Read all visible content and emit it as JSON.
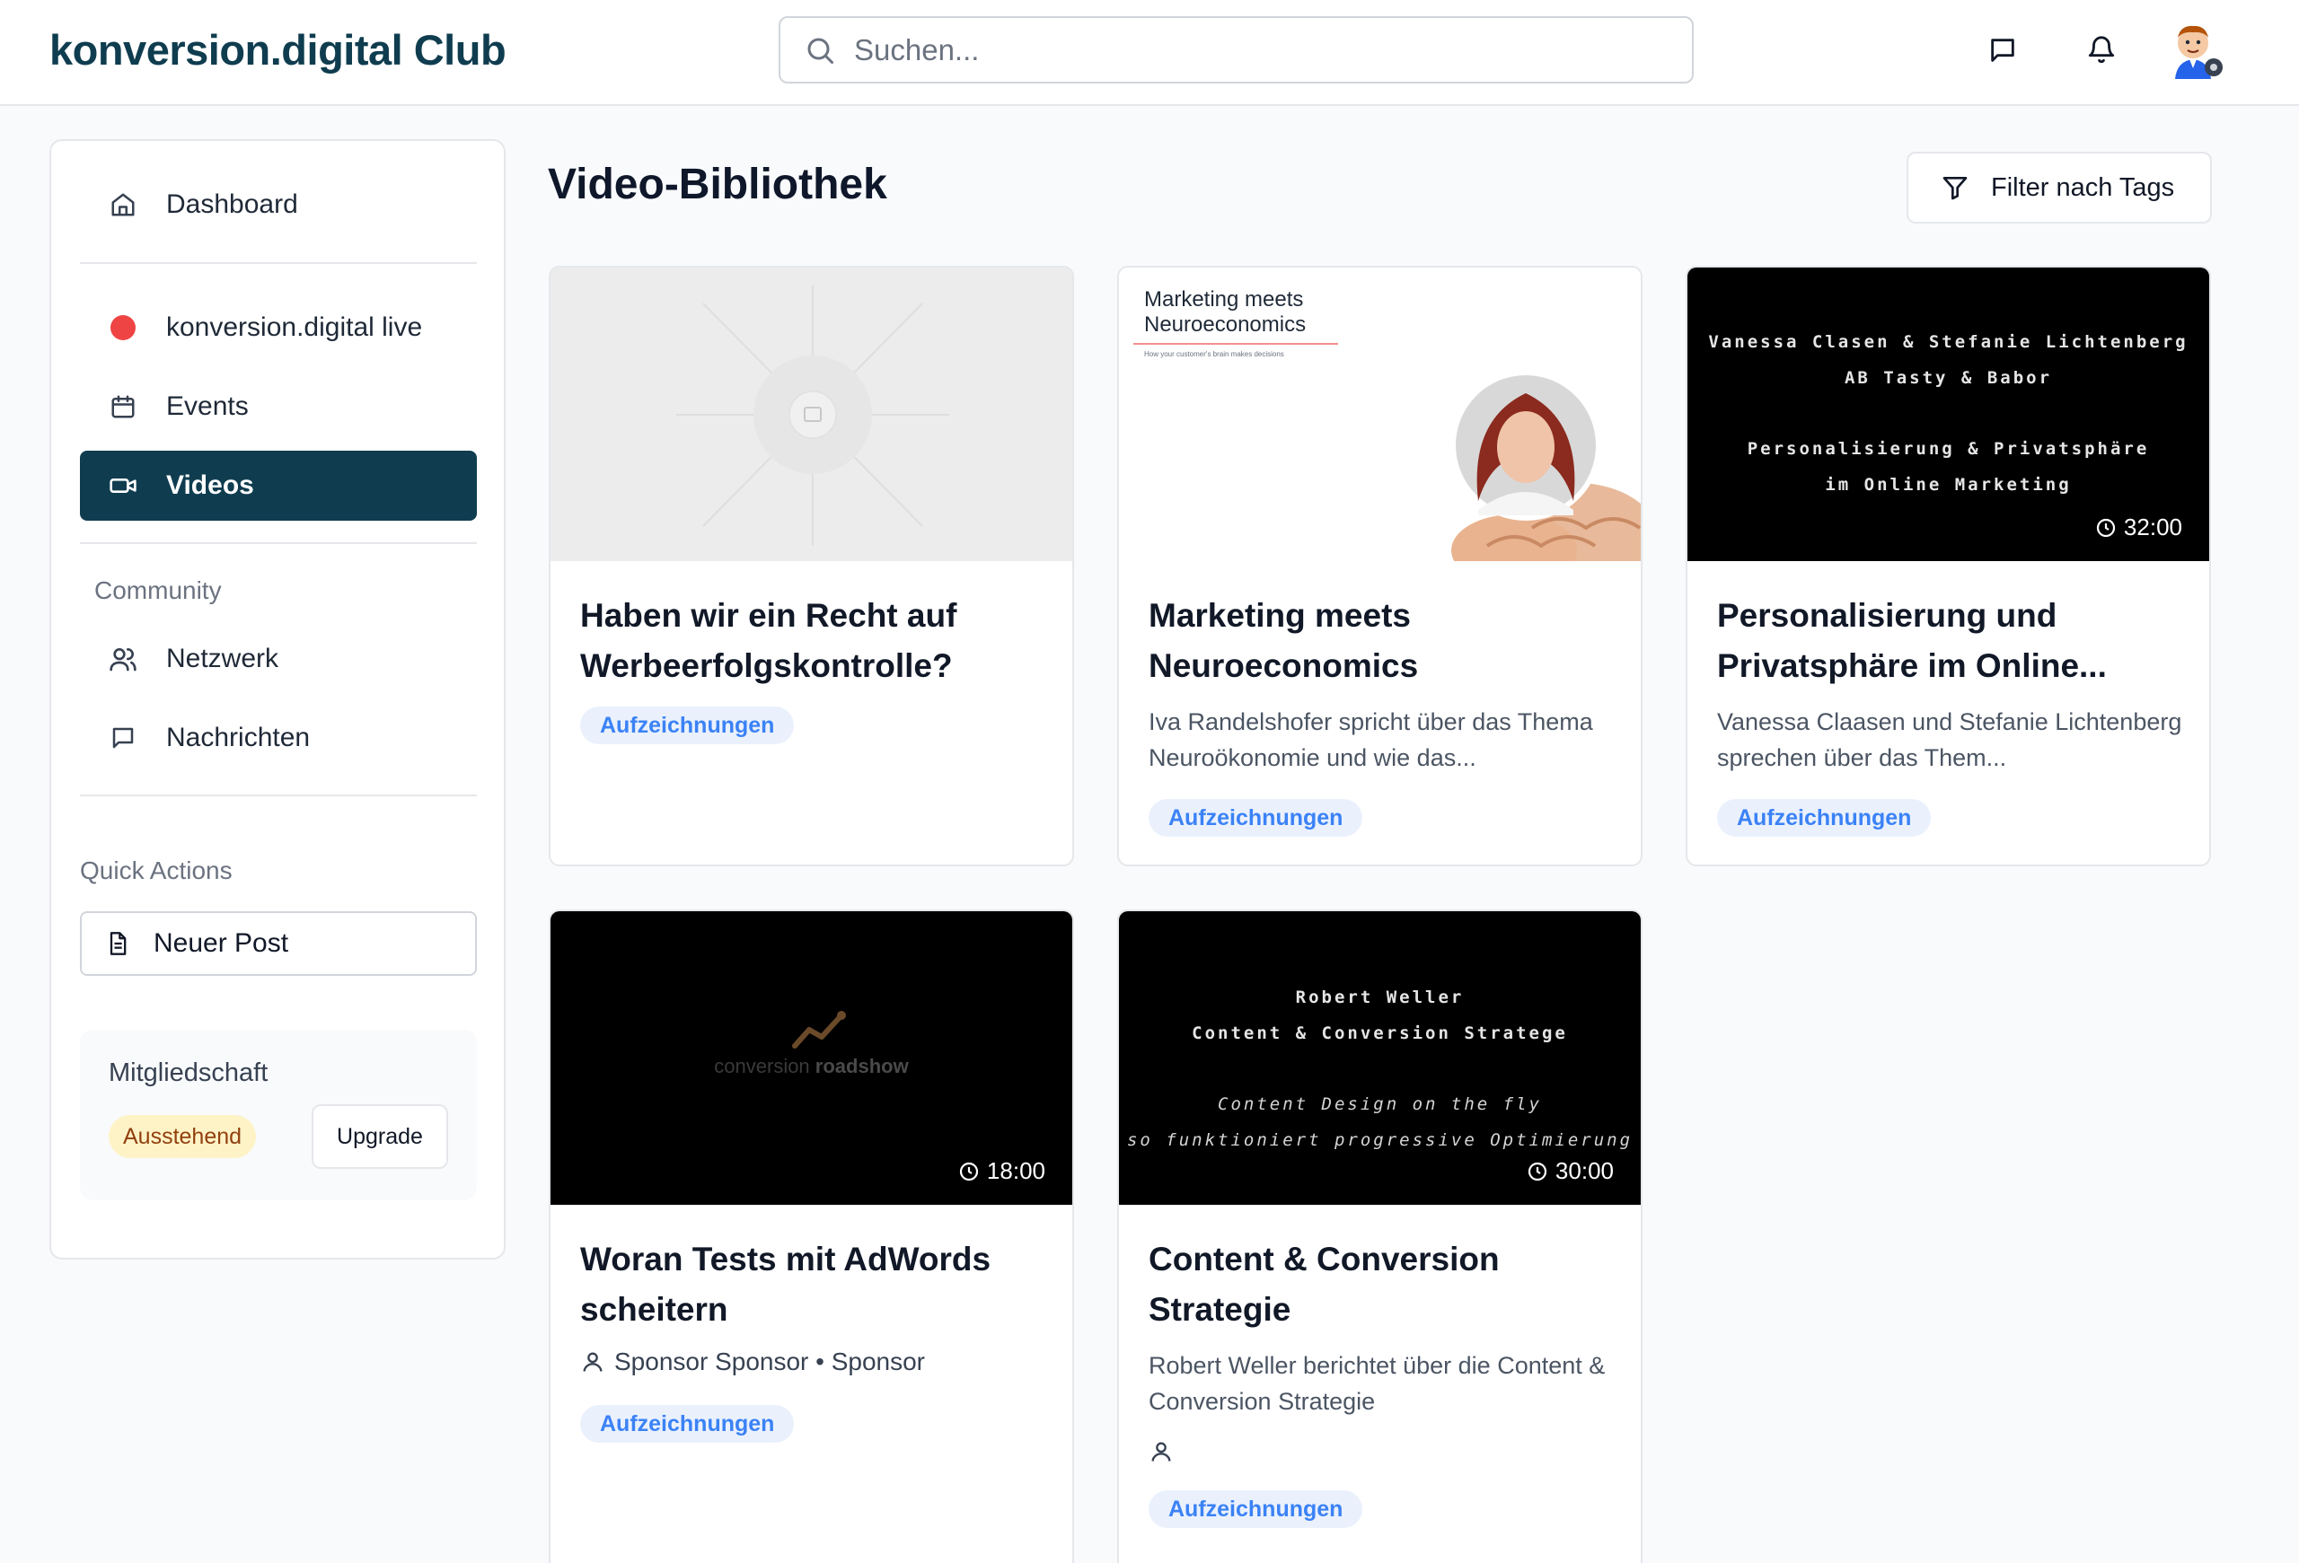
{
  "header": {
    "brand": "konversion.digital Club",
    "search_placeholder": "Suchen..."
  },
  "sidebar": {
    "items": [
      {
        "label": "Dashboard",
        "icon": "home-icon"
      },
      {
        "label": "konversion.digital live",
        "icon": "live-dot-icon"
      },
      {
        "label": "Events",
        "icon": "calendar-icon"
      },
      {
        "label": "Videos",
        "icon": "video-icon",
        "active": true
      },
      {
        "label": "Netzwerk",
        "icon": "users-icon"
      },
      {
        "label": "Nachrichten",
        "icon": "message-icon"
      }
    ],
    "community_label": "Community",
    "quick_actions_label": "Quick Actions",
    "new_post_label": "Neuer Post",
    "membership": {
      "title": "Mitgliedschaft",
      "status": "Ausstehend",
      "upgrade_label": "Upgrade"
    }
  },
  "main": {
    "title": "Video-Bibliothek",
    "filter_label": "Filter nach Tags",
    "videos": [
      {
        "title": "Haben wir ein Recht auf Werbeerfolgskontrolle?",
        "tag": "Aufzeichnungen"
      },
      {
        "title": "Marketing meets Neuroeconomics",
        "description": "Iva Randelshofer spricht über das Thema Neuroökonomie und wie das...",
        "tag": "Aufzeichnungen",
        "thumb_title": "Marketing meets Neuroeconomics",
        "thumb_sub": "How your customer's brain makes decisions"
      },
      {
        "title": "Personalisierung und Privatsphäre im Online...",
        "description": "Vanessa Claasen und Stefanie Lichtenberg sprechen über das Them...",
        "tag": "Aufzeichnungen",
        "duration": "32:00",
        "thumb_lines": [
          "Vanessa Clasen & Stefanie Lichtenberg",
          "AB Tasty & Babor",
          "Personalisierung & Privatsphäre",
          "im Online Marketing"
        ]
      },
      {
        "title": "Woran Tests mit AdWords scheitern",
        "meta": "Sponsor Sponsor • Sponsor",
        "tag": "Aufzeichnungen",
        "duration": "18:00",
        "thumb_logo_a": "conversion",
        "thumb_logo_b": "roadshow"
      },
      {
        "title": "Content & Conversion Strategie",
        "description": "Robert Weller berichtet über die Content & Conversion Strategie",
        "tag": "Aufzeichnungen",
        "duration": "30:00",
        "thumb_lines": [
          "Robert Weller",
          "Content & Conversion Stratege",
          "Content Design on the fly",
          "so funktioniert progressive Optimierung"
        ]
      }
    ]
  },
  "colors": {
    "brand": "#0f3d4f",
    "tag_bg": "#eaf1fd",
    "tag_text": "#3b82f6",
    "live": "#ef4444",
    "pending_bg": "#fef3c7"
  }
}
